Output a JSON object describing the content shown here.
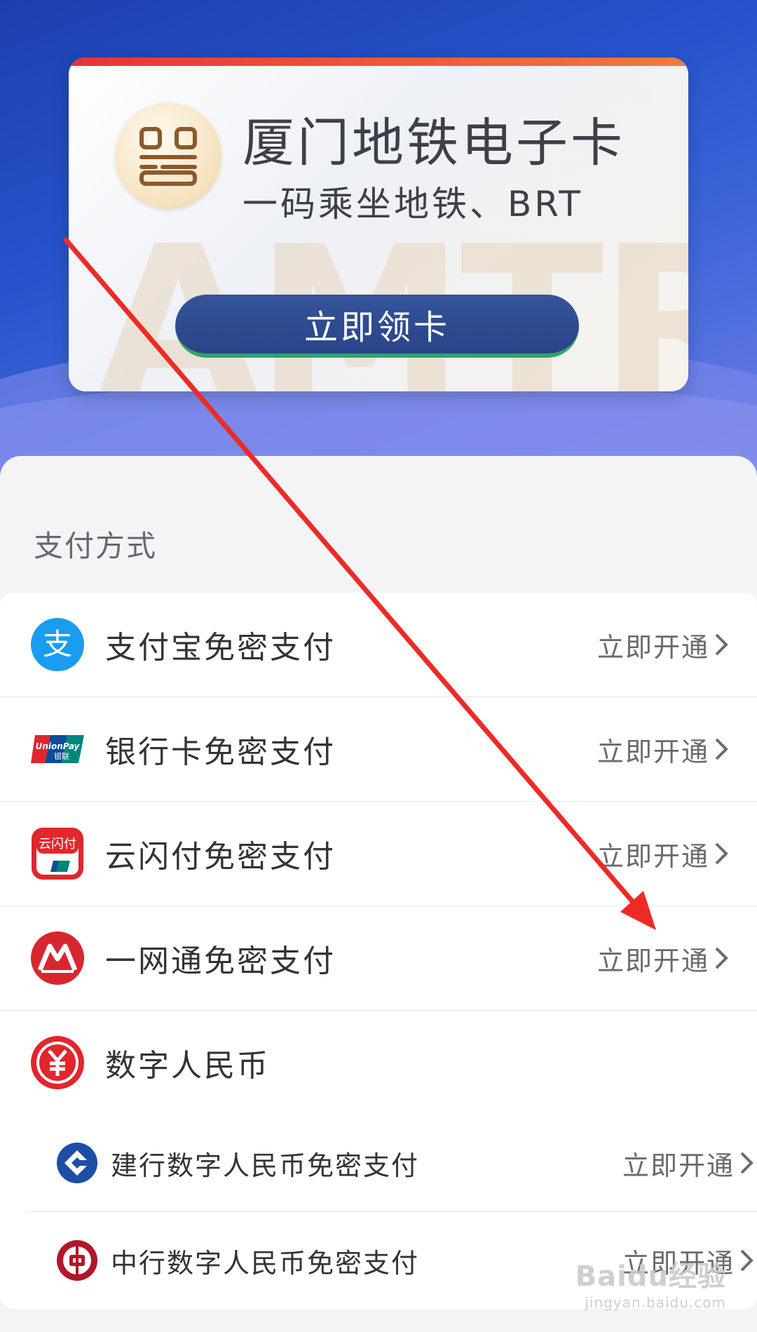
{
  "card": {
    "title": "厦门地铁电子卡",
    "subtitle": "一码乘坐地铁、BRT",
    "watermark": "AMTR",
    "button_label": "立即领卡",
    "logo_icon": "metro-qr-logo-icon"
  },
  "payment": {
    "section_title": "支付方式",
    "methods": [
      {
        "label": "支付宝免密支付",
        "action": "立即开通",
        "icon": "alipay-icon"
      },
      {
        "label": "银行卡免密支付",
        "action": "立即开通",
        "icon": "unionpay-icon"
      },
      {
        "label": "云闪付免密支付",
        "action": "立即开通",
        "icon": "quickpass-icon"
      },
      {
        "label": "一网通免密支付",
        "action": "立即开通",
        "icon": "cmb-icon"
      }
    ],
    "ecny": {
      "label": "数字人民币",
      "icon": "ecny-icon",
      "banks": [
        {
          "label": "建行数字人民币免密支付",
          "action": "立即开通",
          "icon": "ccb-icon"
        },
        {
          "label": "中行数字人民币免密支付",
          "action": "立即开通",
          "icon": "boc-icon"
        }
      ]
    }
  },
  "overlay": {
    "annotation_arrow_color": "#ee2a24",
    "watermark_brand": "Baidu经验",
    "watermark_url": "jingyan.baidu.com"
  },
  "colors": {
    "hero_blue": "#2552c9",
    "button_navy": "#2a4488",
    "alipay_blue": "#1a9cf0",
    "unionpay_red": "#e1262c",
    "cmb_red": "#d8262e",
    "ccb_blue": "#1d4ea6",
    "boc_red": "#b0182a"
  }
}
